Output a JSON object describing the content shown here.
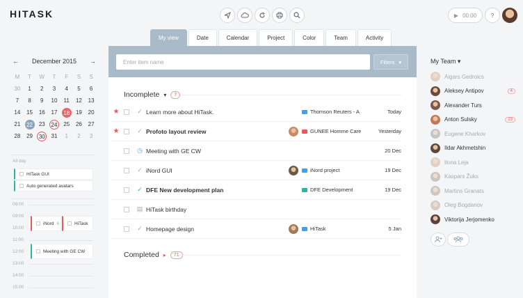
{
  "app": {
    "logo": "HITASK"
  },
  "topbar": {
    "timer": "00:00",
    "help": "?"
  },
  "tabs": [
    "My view",
    "Date",
    "Calendar",
    "Project",
    "Color",
    "Team",
    "Activity"
  ],
  "search": {
    "placeholder": "Enter item name",
    "filters_label": "Filters"
  },
  "calendar": {
    "month": "December 2015",
    "prev": "←",
    "next": "→",
    "weekdays": [
      "M",
      "T",
      "W",
      "T",
      "F",
      "S",
      "S"
    ],
    "days": [
      [
        "30",
        "1",
        "2",
        "3",
        "4",
        "5",
        "6"
      ],
      [
        "7",
        "8",
        "9",
        "10",
        "11",
        "12",
        "13"
      ],
      [
        "14",
        "15",
        "16",
        "17",
        "18",
        "19",
        "20"
      ],
      [
        "21",
        "22",
        "23",
        "24",
        "25",
        "26",
        "27"
      ],
      [
        "28",
        "29",
        "30",
        "31",
        "1",
        "2",
        "3"
      ]
    ],
    "today": "18",
    "selected": "22",
    "ringed": [
      "24",
      "30"
    ]
  },
  "allday": {
    "label": "All day",
    "events": [
      {
        "title": "HiTask GUI",
        "color": "#2bb5a5"
      },
      {
        "title": "Auto generated avatars",
        "color": "#2bb5a5"
      }
    ]
  },
  "timeline": {
    "times": [
      "08:00",
      "09:00",
      "10:00",
      "11:00",
      "12:00",
      "13:00",
      "14:00",
      "15:00"
    ],
    "slots": [
      {
        "title": "iNord",
        "extra": "6",
        "color": "#e85a5a"
      },
      {
        "title": "HiTask",
        "extra": "",
        "color": "#e85a5a"
      },
      {
        "title": "Meeting with GE CW",
        "extra": "",
        "color": "#2bb5a5"
      }
    ]
  },
  "incomplete": {
    "label": "Incomplete",
    "count": "7",
    "arrow": "▾"
  },
  "completed": {
    "label": "Completed",
    "count": "71",
    "arrow": "▸"
  },
  "tasks": [
    {
      "starred": true,
      "icon": "check",
      "title": "Learn more about HiTask.",
      "bold": false,
      "avatar": "",
      "project": "Thomson Reuters - A",
      "folder": "#4a9ee0",
      "date": "Today"
    },
    {
      "starred": true,
      "icon": "check",
      "title": "Profoto layout review",
      "bold": true,
      "avatar": "#c98a6a",
      "project": "GUNEE Homme Care",
      "folder": "#e85a5a",
      "date": "Yesterday"
    },
    {
      "starred": false,
      "icon": "clock",
      "title": "Meeting with GE CW",
      "bold": false,
      "avatar": "",
      "project": "",
      "folder": "",
      "date": "20 Dec"
    },
    {
      "starred": false,
      "icon": "check",
      "title": "iNord GUI",
      "bold": false,
      "avatar": "#6a5a4a",
      "project": "iNord project",
      "folder": "#4a9ee0",
      "date": "19 Dec"
    },
    {
      "starred": false,
      "icon": "done",
      "title": "DFE New development plan",
      "bold": true,
      "avatar": "",
      "project": "DFE Development",
      "folder": "#2bb5a5",
      "date": "19 Dec"
    },
    {
      "starred": false,
      "icon": "doc",
      "title": "HiTask birthday",
      "bold": false,
      "avatar": "",
      "project": "",
      "folder": "",
      "date": ""
    },
    {
      "starred": false,
      "icon": "check",
      "title": "Homepage design",
      "bold": false,
      "avatar": "#a07a5a",
      "project": "HiTask",
      "folder": "#4a9ee0",
      "date": "5 Jan"
    }
  ],
  "team": {
    "title": "My Team",
    "members": [
      {
        "name": "Aigars Gedroics",
        "count": "",
        "faded": true,
        "color": "#c9a48a"
      },
      {
        "name": "Aleksey Antipov",
        "count": "4",
        "faded": false,
        "color": "#6a4a3a"
      },
      {
        "name": "Alexander Turs",
        "count": "",
        "faded": false,
        "color": "#7a5a4a"
      },
      {
        "name": "Anton Sulsky",
        "count": "23",
        "faded": false,
        "color": "#c07a5a"
      },
      {
        "name": "Eugene Kharkov",
        "count": "",
        "faded": true,
        "color": "#8a8a8a"
      },
      {
        "name": "Ildar Akhmetshin",
        "count": "",
        "faded": false,
        "color": "#5a4a3a"
      },
      {
        "name": "Ilona Leja",
        "count": "",
        "faded": true,
        "color": "#c9a48a"
      },
      {
        "name": "Kaspars Žuks",
        "count": "",
        "faded": true,
        "color": "#9a8a7a"
      },
      {
        "name": "Martins Granats",
        "count": "",
        "faded": true,
        "color": "#a09080"
      },
      {
        "name": "Oleg Bogdanov",
        "count": "",
        "faded": true,
        "color": "#b09a8a"
      },
      {
        "name": "Viktorija Jerjomenko",
        "count": "",
        "faded": false,
        "color": "#5a4040"
      }
    ]
  }
}
